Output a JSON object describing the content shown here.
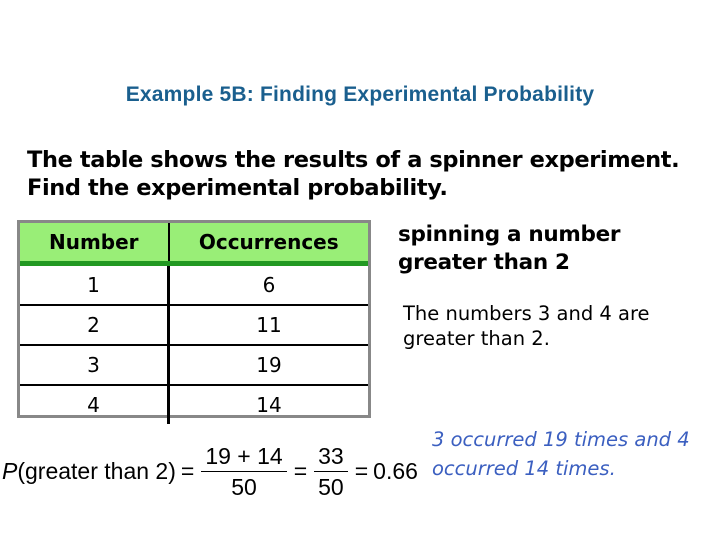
{
  "title": "Example 5B: Finding Experimental Probability",
  "prompt": "The table shows the results of a spinner experiment. Find the experimental probability.",
  "table": {
    "headers": [
      "Number",
      "Occurrences"
    ],
    "rows": [
      [
        "1",
        "6"
      ],
      [
        "2",
        "11"
      ],
      [
        "3",
        "19"
      ],
      [
        "4",
        "14"
      ]
    ],
    "header_bg": "#99ee77",
    "header_rule": "#229922"
  },
  "event": "spinning a number greater than 2",
  "note": "The numbers 3 and 4 are greater than 2.",
  "formula": {
    "p": "P",
    "arg": "(greater than 2)",
    "eq": "=",
    "frac1_num": "19 + 14",
    "frac1_den": "50",
    "frac2_num": "33",
    "frac2_den": "50",
    "result": "0.66"
  },
  "explanation": "3 occurred 19 times and 4 occurred 14 times.",
  "colors": {
    "title": "#1a5f8e",
    "explanation": "#3b5fc0"
  }
}
